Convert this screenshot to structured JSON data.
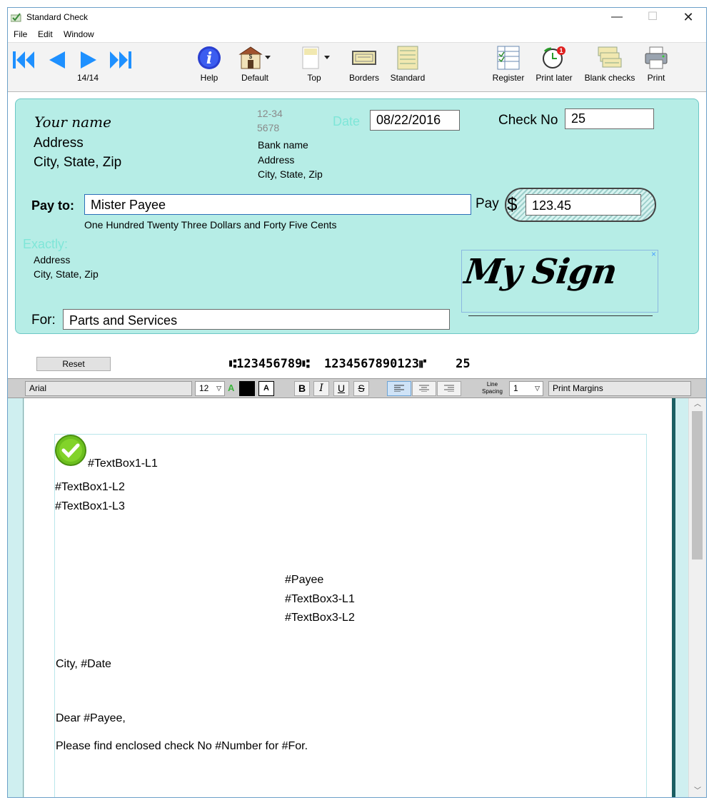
{
  "window": {
    "title": "Standard Check",
    "minimize": "—",
    "maximize": "☐",
    "close": "✕"
  },
  "menu": [
    "File",
    "Edit",
    "Window"
  ],
  "toolbar": {
    "page_counter": "14/14",
    "help": "Help",
    "default": "Default",
    "top": "Top",
    "borders": "Borders",
    "standard": "Standard",
    "register": "Register",
    "print_later": "Print later",
    "print_later_badge": "1",
    "blank_checks": "Blank checks",
    "print": "Print"
  },
  "check": {
    "your_name": "Your name",
    "address": "Address",
    "city_state_zip": "City, State, Zip",
    "routing_top": "12-34",
    "routing_bottom": "5678",
    "bank_name": "Bank name",
    "bank_address": "Address",
    "bank_city": "City, State, Zip",
    "date_label": "Date",
    "date_value": "08/22/2016",
    "check_no_label": "Check No",
    "check_no_value": "25",
    "pay_to_label": "Pay to:",
    "payee_value": "Mister Payee",
    "pay_label": "Pay",
    "dollar_sign": "$",
    "amount_value": "123.45",
    "amount_words": "One Hundred Twenty Three Dollars and Forty Five Cents",
    "exactly_label": "Exactly:",
    "payee_address": "Address",
    "payee_city": "City, State, Zip",
    "signature": "My Sign",
    "sig_close": "×",
    "for_label": "For:",
    "for_value": "Parts and Services",
    "reset": "Reset",
    "micr": "⑆123456789⑆  1234567890123⑈    25"
  },
  "format": {
    "font": "Arial",
    "size": "12",
    "color_glyph": "A",
    "bg_glyph": "A",
    "bold": "B",
    "italic": "I",
    "underline": "U",
    "strike": "S",
    "line_spacing_label_1": "Line",
    "line_spacing_label_2": "Spacing",
    "line_spacing_value": "1",
    "print_margins": "Print Margins"
  },
  "document": {
    "l1": "#TextBox1-L1",
    "l2": "#TextBox1-L2",
    "l3": "#TextBox1-L3",
    "payee": "#Payee",
    "tb3_l1": "#TextBox3-L1",
    "tb3_l2": "#TextBox3-L2",
    "city_date": "City, #Date",
    "dear": "Dear #Payee,",
    "body": "Please find enclosed check No #Number for #For."
  },
  "colors": {
    "check_bg": "#b6ede6",
    "accent": "#1e90ff",
    "label_faded": "#7fe6d8"
  }
}
